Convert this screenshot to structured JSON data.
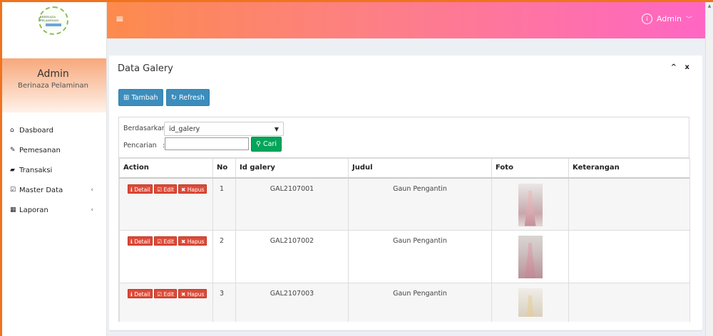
{
  "logo": {
    "text": "BERINAZA PELAMINAN"
  },
  "sidebar": {
    "user_name": "Admin",
    "user_sub": "Berinaza Pelaminan",
    "menu": [
      {
        "label": "Dasboard",
        "icon": "home-icon"
      },
      {
        "label": "Pemesanan",
        "icon": "pencil-icon"
      },
      {
        "label": "Transaksi",
        "icon": "book-icon"
      },
      {
        "label": "Master Data",
        "icon": "edit-icon",
        "chevron": "‹"
      },
      {
        "label": "Laporan",
        "icon": "calendar-icon",
        "chevron": "‹"
      }
    ]
  },
  "header": {
    "menu_icon": "≡",
    "user_label": "Admin"
  },
  "box": {
    "title": "Data Galery",
    "tools": [
      "^",
      "x"
    ]
  },
  "toolbar": {
    "tambah_label": "Tambah",
    "refresh_label": "Refresh"
  },
  "filter": {
    "berdasarkan_label": "Berdasarkan:",
    "selected_field": "id_galery",
    "pencarian_label": "Pencarian",
    "colon": ":",
    "search_value": "",
    "cari_label": "Cari"
  },
  "table": {
    "columns": [
      "Action",
      "No",
      "Id galery",
      "Judul",
      "Foto",
      "Keterangan"
    ],
    "action_labels": {
      "detail": "Detail",
      "edit": "Edit",
      "hapus": "Hapus"
    },
    "rows": [
      {
        "no": "1",
        "id": "GAL2107001",
        "judul": "Gaun Pengantin",
        "keterangan": ""
      },
      {
        "no": "2",
        "id": "GAL2107002",
        "judul": "Gaun Pengantin",
        "keterangan": ""
      },
      {
        "no": "3",
        "id": "GAL2107003",
        "judul": "Gaun Pengantin",
        "keterangan": ""
      }
    ]
  },
  "colors": {
    "frame": "#f0731e",
    "header_start": "#fc8b4c",
    "header_end": "#ff66c4",
    "primary": "#3c8dbc",
    "success": "#00a65a",
    "danger": "#dd4b39"
  }
}
